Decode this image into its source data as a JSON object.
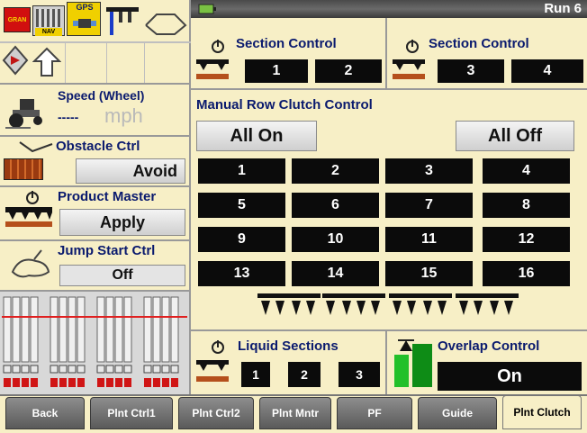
{
  "header": {
    "run_label": "Run 6"
  },
  "left_status": {
    "gran_badge": "GRAN",
    "nav_badge": "NAV",
    "gps_badge": "GPS"
  },
  "speed": {
    "label": "Speed (Wheel)",
    "value": "-----",
    "unit": "mph"
  },
  "obstacle": {
    "label": "Obstacle Ctrl",
    "button": "Avoid"
  },
  "product_master": {
    "label": "Product Master",
    "button": "Apply"
  },
  "jump_start": {
    "label": "Jump Start Ctrl",
    "value": "Off"
  },
  "section_control_left": {
    "label": "Section Control",
    "buttons": [
      "1",
      "2"
    ]
  },
  "section_control_right": {
    "label": "Section Control",
    "buttons": [
      "3",
      "4"
    ]
  },
  "manual_row": {
    "label": "Manual Row Clutch Control",
    "all_on": "All On",
    "all_off": "All Off",
    "rows": [
      [
        "1",
        "2",
        "3",
        "4"
      ],
      [
        "5",
        "6",
        "7",
        "8"
      ],
      [
        "9",
        "10",
        "11",
        "12"
      ],
      [
        "13",
        "14",
        "15",
        "16"
      ]
    ]
  },
  "liquid": {
    "label": "Liquid Sections",
    "buttons": [
      "1",
      "2",
      "3"
    ]
  },
  "overlap": {
    "label": "Overlap Control",
    "value": "On"
  },
  "tabs": [
    "Back",
    "Plnt Ctrl1",
    "Plnt Ctrl2",
    "Plnt Mntr",
    "PF",
    "Guide",
    "Plnt Clutch"
  ],
  "colors": {
    "panel_bg": "#f7efc6",
    "label_blue": "#0a1a6e",
    "button_black": "#0b0b0b",
    "overlap_green": "#22c02a"
  }
}
